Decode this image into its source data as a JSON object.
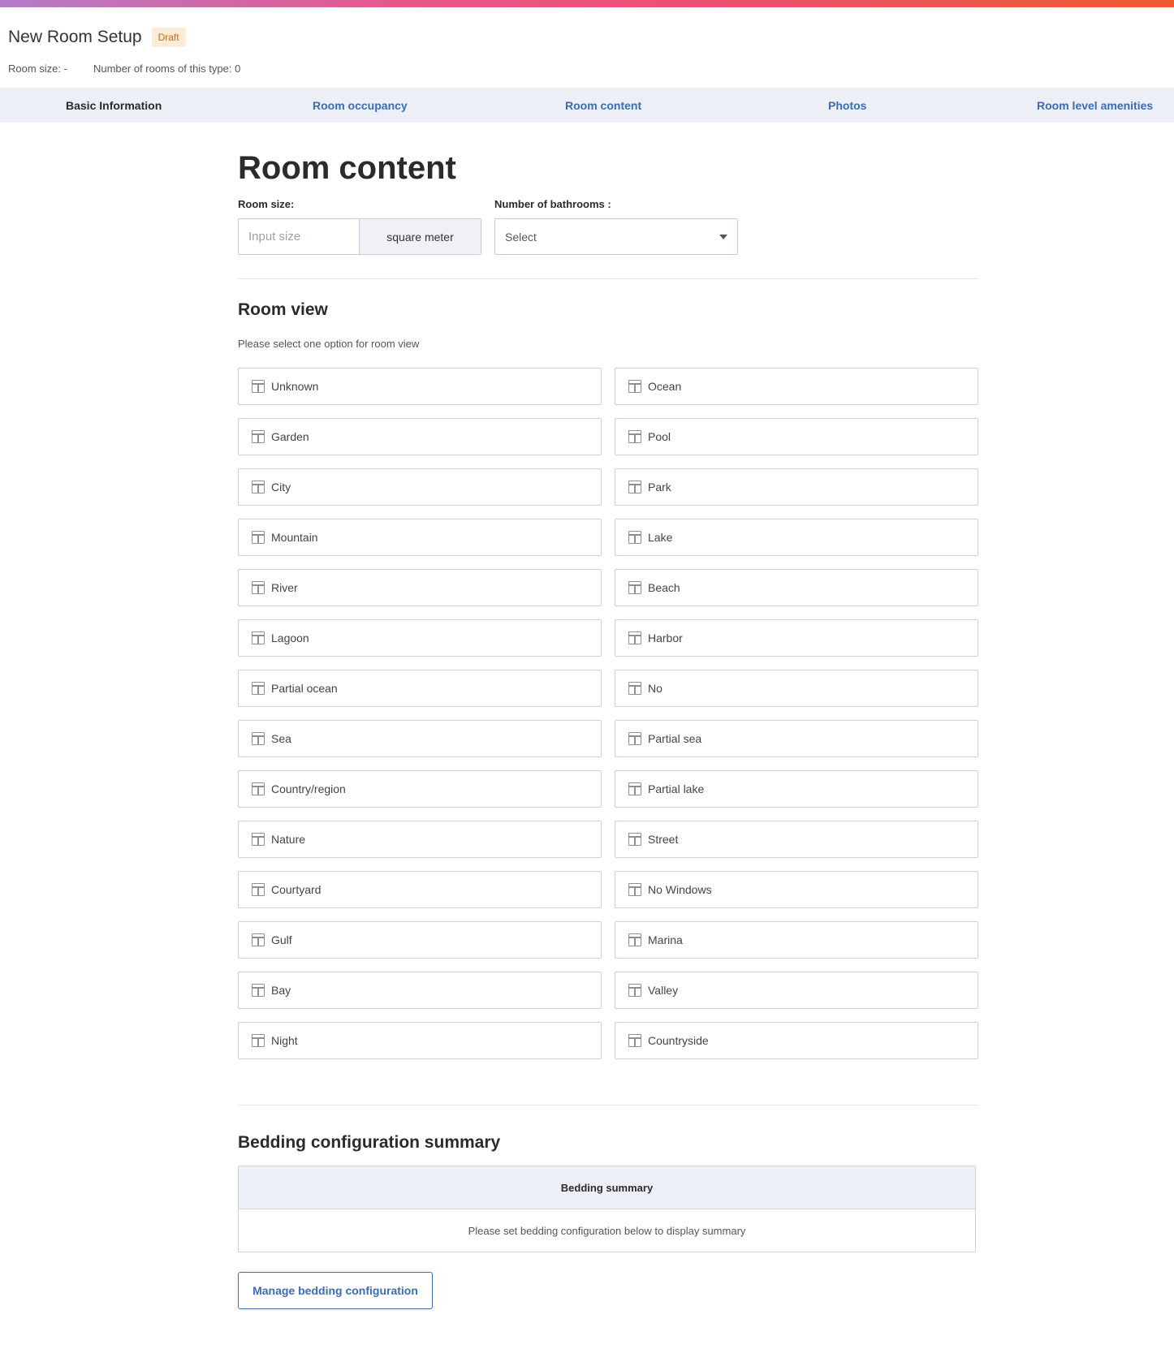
{
  "header": {
    "title": "New Room Setup",
    "badge": "Draft",
    "room_size_meta": "Room size: -",
    "rooms_count_meta": "Number of rooms of this type: 0"
  },
  "tabs": [
    {
      "label": "Basic Information",
      "active": true
    },
    {
      "label": "Room occupancy",
      "active": false
    },
    {
      "label": "Room content",
      "active": false
    },
    {
      "label": "Photos",
      "active": false
    },
    {
      "label": "Room level amenities",
      "active": false
    }
  ],
  "room_content": {
    "heading": "Room content",
    "room_size_label": "Room size:",
    "room_size_placeholder": "Input size",
    "room_size_unit": "square meter",
    "bathrooms_label": "Number of bathrooms :",
    "bathrooms_value": "Select"
  },
  "room_view": {
    "heading": "Room view",
    "hint": "Please select one option for room view",
    "icon": "window-icon",
    "options": [
      "Unknown",
      "Ocean",
      "Garden",
      "Pool",
      "City",
      "Park",
      "Mountain",
      "Lake",
      "River",
      "Beach",
      "Lagoon",
      "Harbor",
      "Partial ocean",
      "No",
      "Sea",
      "Partial sea",
      "Country/region",
      "Partial lake",
      "Nature",
      "Street",
      "Courtyard",
      "No Windows",
      "Gulf",
      "Marina",
      "Bay",
      "Valley",
      "Night",
      "Countryside"
    ]
  },
  "bedding": {
    "heading": "Bedding configuration summary",
    "table_header": "Bedding summary",
    "empty_message": "Please set bedding configuration below to display summary",
    "manage_button": "Manage bedding configuration"
  },
  "colors": {
    "accent": "#3b6cb4",
    "tab_bar": "#eceff5",
    "badge_bg": "#fdecd8",
    "badge_text": "#c86a1a"
  }
}
